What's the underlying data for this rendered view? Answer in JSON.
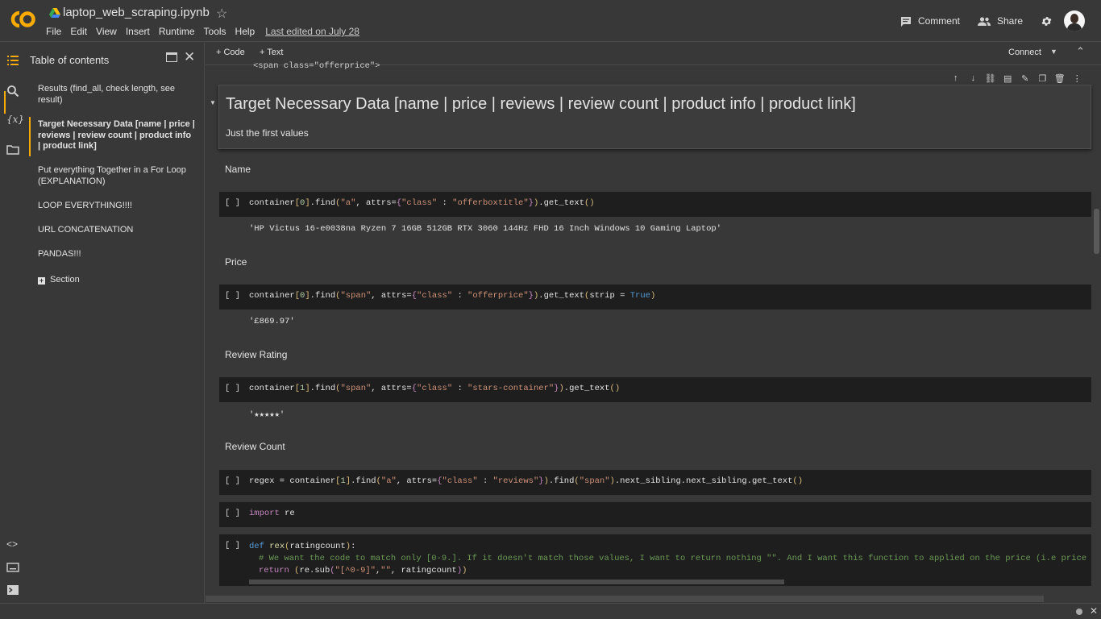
{
  "header": {
    "title": "laptop_web_scraping.ipynb",
    "menu": [
      "File",
      "Edit",
      "View",
      "Insert",
      "Runtime",
      "Tools",
      "Help"
    ],
    "last_edited": "Last edited on July 28",
    "comment_label": "Comment",
    "share_label": "Share"
  },
  "toc": {
    "title": "Table of contents",
    "items": [
      "Results (find_all, check length, see result)",
      "Target Necessary Data [name | price | reviews | review count | product info | product link]",
      "Put everything Together in a For Loop (EXPLANATION)",
      "LOOP EVERYTHING!!!!",
      "URL CONCATENATION",
      "PANDAS!!!",
      "Section"
    ]
  },
  "toolbar": {
    "code_label": "+ Code",
    "text_label": "+ Text",
    "connect_label": "Connect"
  },
  "notebook": {
    "prev_output": "<span class=\"offerprice\">",
    "heading": "Target Necessary Data [name | price | reviews | review count | product info | product link]",
    "subheading": "Just the first values",
    "sections": {
      "name": "Name",
      "price": "Price",
      "rating": "Review Rating",
      "count": "Review Count"
    },
    "run_bracket": "[ ]",
    "outputs": {
      "name": "'HP Victus 16-e0038na Ryzen 7 16GB 512GB RTX 3060 144Hz FHD 16 Inch Windows 10 Gaming Laptop'",
      "price": "'£869.97'",
      "rating": "'★★★★★'"
    }
  }
}
